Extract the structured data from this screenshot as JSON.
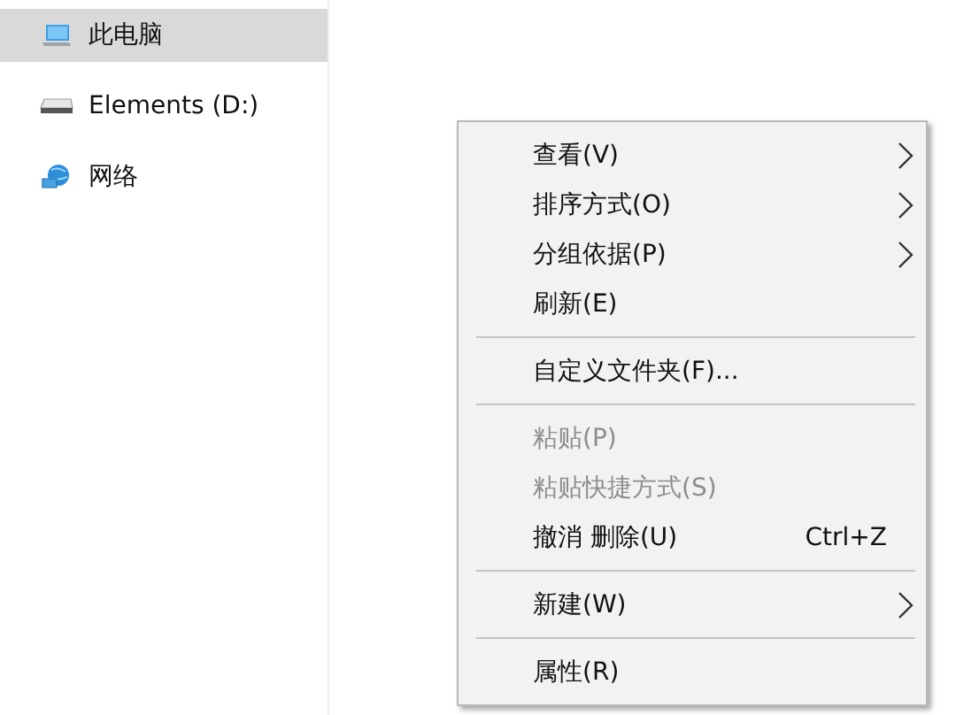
{
  "nav_pane": {
    "items": [
      {
        "label": "此电脑",
        "kind": "computer",
        "selected": true
      },
      {
        "label": "Elements (D:)",
        "kind": "drive",
        "selected": false
      },
      {
        "label": "网络",
        "kind": "network",
        "selected": false
      }
    ]
  },
  "context_menu": {
    "items": [
      {
        "kind": "item",
        "label": "查看(V)",
        "submenu": true,
        "disabled": false
      },
      {
        "kind": "item",
        "label": "排序方式(O)",
        "submenu": true,
        "disabled": false
      },
      {
        "kind": "item",
        "label": "分组依据(P)",
        "submenu": true,
        "disabled": false
      },
      {
        "kind": "item",
        "label": "刷新(E)",
        "submenu": false,
        "disabled": false
      },
      {
        "kind": "separator"
      },
      {
        "kind": "item",
        "label": "自定义文件夹(F)...",
        "submenu": false,
        "disabled": false
      },
      {
        "kind": "separator"
      },
      {
        "kind": "item",
        "label": "粘贴(P)",
        "submenu": false,
        "disabled": true
      },
      {
        "kind": "item",
        "label": "粘贴快捷方式(S)",
        "submenu": false,
        "disabled": true
      },
      {
        "kind": "item",
        "label": "撤消 删除(U)",
        "shortcut": "Ctrl+Z",
        "submenu": false,
        "disabled": false
      },
      {
        "kind": "separator"
      },
      {
        "kind": "item",
        "label": "新建(W)",
        "submenu": true,
        "disabled": false
      },
      {
        "kind": "separator"
      },
      {
        "kind": "item",
        "label": "属性(R)",
        "submenu": false,
        "disabled": false
      }
    ]
  }
}
